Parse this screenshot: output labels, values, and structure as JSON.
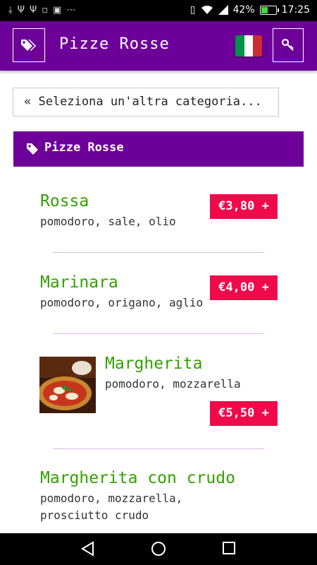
{
  "status_bar": {
    "battery": "42%",
    "battery_level": 0.42,
    "time": "17:25"
  },
  "app_bar": {
    "title": "Pizze Rosse",
    "language_flag_colors": [
      "#009246",
      "#ffffff",
      "#ce2b37"
    ]
  },
  "category_selector": {
    "label": "« Seleziona un'altra categoria..."
  },
  "section": {
    "title": "Pizze Rosse"
  },
  "products": [
    {
      "name": "Rossa",
      "description": "pomodoro, sale, olio",
      "price": "€3,80 +"
    },
    {
      "name": "Marinara",
      "description": "pomodoro, origano, aglio",
      "price": "€4,00 +"
    },
    {
      "name": "Margherita",
      "description": "pomodoro, mozzarella",
      "price": "€5,50 +"
    },
    {
      "name": "Margherita con crudo",
      "description": "pomodoro, mozzarella, prosciutto crudo"
    }
  ],
  "colors": {
    "primary": "#6d0099",
    "accent": "#f0094b",
    "product_name": "#33a000",
    "divider": "#ddb8e6"
  }
}
